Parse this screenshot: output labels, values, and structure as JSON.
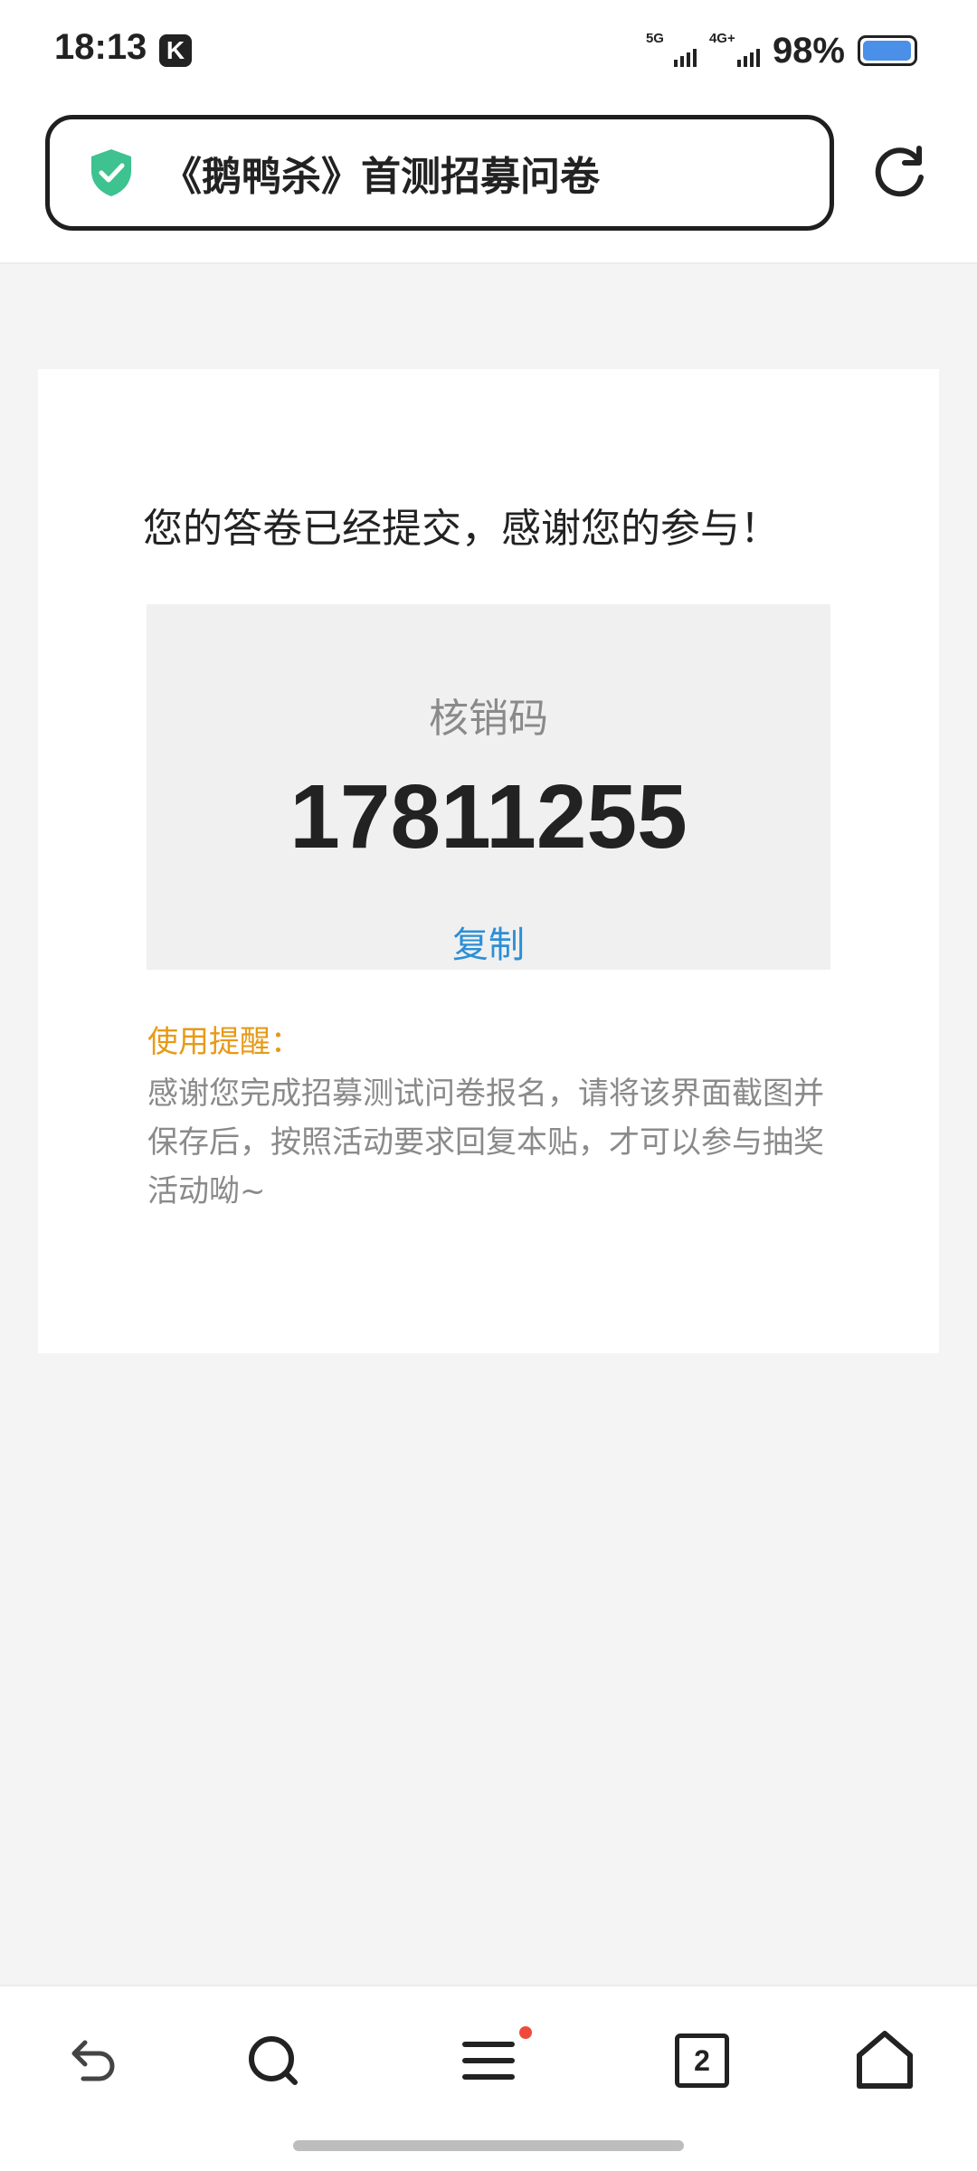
{
  "status_bar": {
    "time": "18:13",
    "app_icon_letter": "K",
    "signal_1_tag": "5G",
    "signal_2_tag": "4G+",
    "battery_text": "98%",
    "battery_level": 0.98
  },
  "browser": {
    "url_title": "《鹅鸭杀》首测招募问卷",
    "secure_icon": "shield-check-icon",
    "reload_icon": "reload-icon"
  },
  "result": {
    "thanks_message": "您的答卷已经提交，感谢您的参与！",
    "code_label": "核销码",
    "code_value": "17811255",
    "copy_label": "复制",
    "reminder_title": "使用提醒：",
    "reminder_text": "感谢您完成招募测试问卷报名，请将该界面截图并保存后，按照活动要求回复本贴，才可以参与抽奖活动呦~"
  },
  "bottom_nav": {
    "items": [
      {
        "icon": "back-icon"
      },
      {
        "icon": "search-icon"
      },
      {
        "icon": "menu-icon",
        "has_notification": true
      },
      {
        "icon": "tabs-icon",
        "tabs_count": "2"
      },
      {
        "icon": "home-icon"
      }
    ]
  },
  "colors": {
    "accent_link": "#2b8fd6",
    "reminder_orange": "#e79a17",
    "secure_green": "#3ec28f",
    "notification_red": "#f04a3d",
    "battery_blue": "#4a90e8"
  }
}
